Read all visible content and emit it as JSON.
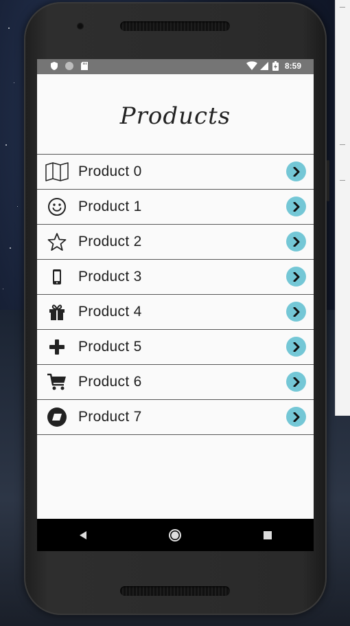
{
  "status_bar": {
    "left_icons": [
      "shield-icon",
      "circle-icon",
      "sd-card-icon"
    ],
    "right_icons": [
      "wifi-icon",
      "cell-signal-icon",
      "battery-icon"
    ],
    "time": "8:59"
  },
  "page": {
    "title": "Products"
  },
  "products": [
    {
      "label": "Product 0",
      "icon": "map-icon"
    },
    {
      "label": "Product 1",
      "icon": "smiley-icon"
    },
    {
      "label": "Product 2",
      "icon": "star-icon"
    },
    {
      "label": "Product 3",
      "icon": "mobile-phone-icon"
    },
    {
      "label": "Product 4",
      "icon": "gift-icon"
    },
    {
      "label": "Product 5",
      "icon": "plus-icon"
    },
    {
      "label": "Product 6",
      "icon": "cart-icon"
    },
    {
      "label": "Product 7",
      "icon": "eraser-icon"
    }
  ],
  "nav_bar": {
    "buttons": [
      "back-icon",
      "home-icon",
      "recents-icon"
    ]
  },
  "colors": {
    "accent": "#74c7d6",
    "status_bar": "#757575",
    "background": "#fafafa"
  }
}
